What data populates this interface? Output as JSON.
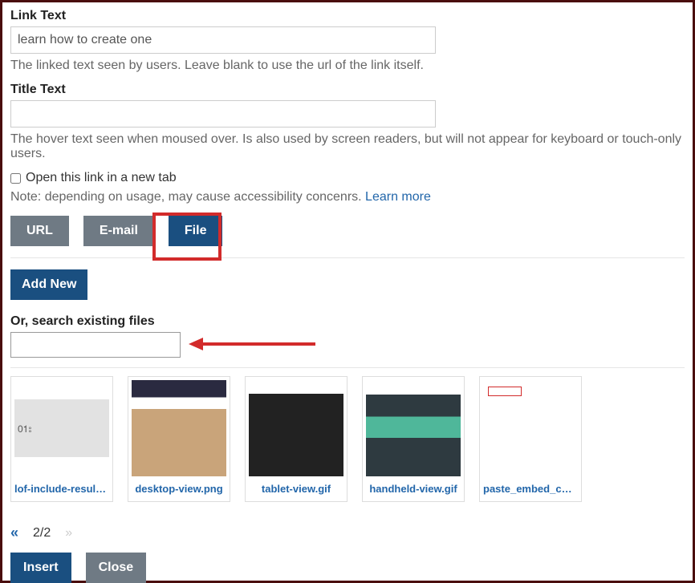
{
  "linkText": {
    "label": "Link Text",
    "value": "learn how to create one",
    "help": "The linked text seen by users. Leave blank to use the url of the link itself."
  },
  "titleText": {
    "label": "Title Text",
    "value": "",
    "help": "The hover text seen when moused over. Is also used by screen readers, but will not appear for keyboard or touch-only users."
  },
  "newTab": {
    "label": "Open this link in a new tab",
    "note": "Note: depending on usage, may cause accessibility concenrs.",
    "learnMore": "Learn more"
  },
  "tabs": {
    "url": "URL",
    "email": "E-mail",
    "file": "File",
    "active": "file"
  },
  "addNew": "Add New",
  "search": {
    "label": "Or, search existing files",
    "value": ""
  },
  "files": [
    {
      "name": "lof-include-result-f...",
      "thumbClass": "t1"
    },
    {
      "name": "desktop-view.png",
      "thumbClass": "t2"
    },
    {
      "name": "tablet-view.gif",
      "thumbClass": "t3"
    },
    {
      "name": "handheld-view.gif",
      "thumbClass": "t4"
    },
    {
      "name": "paste_embed_code..",
      "thumbClass": "t5"
    }
  ],
  "pager": {
    "firstGlyph": "«",
    "label": "2/2",
    "nextGlyph": "»"
  },
  "actions": {
    "insert": "Insert",
    "close": "Close"
  }
}
